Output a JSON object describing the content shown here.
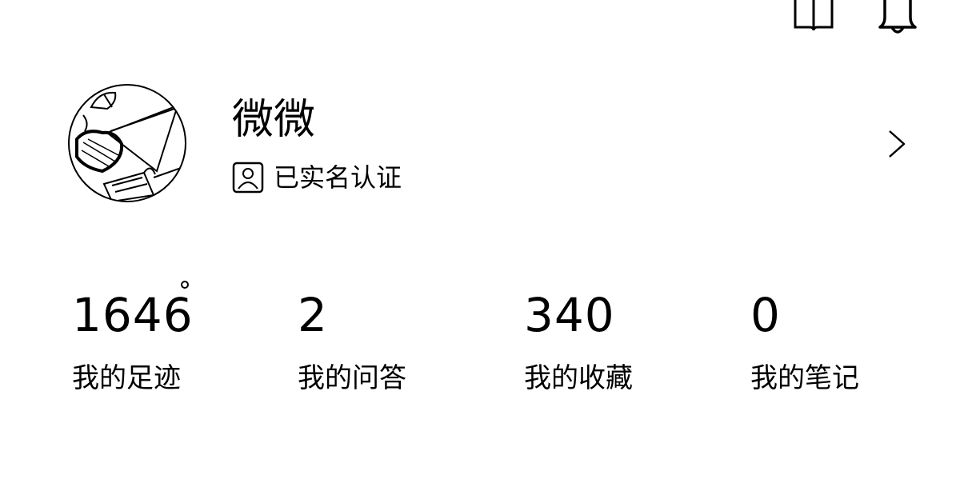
{
  "header": {
    "icons": [
      "book-icon",
      "bell-icon"
    ]
  },
  "profile": {
    "name": "微微",
    "verification": "已实名认证",
    "verify_icon": "id-card-icon",
    "more_icon": "chevron-right-icon"
  },
  "stats": [
    {
      "value": "1646",
      "label": "我的足迹",
      "has_dot": true
    },
    {
      "value": "2",
      "label": "我的问答"
    },
    {
      "value": "340",
      "label": "我的收藏"
    },
    {
      "value": "0",
      "label": "我的笔记"
    }
  ],
  "colors": {
    "text": "#000000",
    "background": "#ffffff"
  }
}
